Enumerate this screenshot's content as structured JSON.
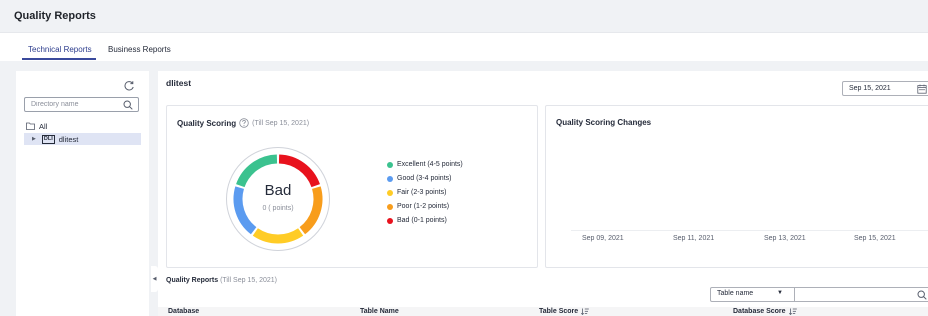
{
  "header": {
    "title": "Quality Reports"
  },
  "tabs": [
    {
      "label": "Technical Reports",
      "active": true
    },
    {
      "label": "Business Reports",
      "active": false
    }
  ],
  "sidebar": {
    "search_placeholder": "Directory name",
    "tree": {
      "root_label": "All",
      "badge": "DLI",
      "db_label": "dlitest"
    }
  },
  "main": {
    "database_title": "dlitest",
    "date_value": "Sep 15, 2021"
  },
  "scoring": {
    "title": "Quality Scoring",
    "subtitle": "(Till Sep 15, 2021)",
    "grade": "Bad",
    "points": "0 ( points)",
    "legend": [
      {
        "label": "Excellent (4-5 points)",
        "color": "#3bc28f"
      },
      {
        "label": "Good (3-4 points)",
        "color": "#5b9bf0"
      },
      {
        "label": "Fair (2-3 points)",
        "color": "#ffcc26"
      },
      {
        "label": "Poor (1-2 points)",
        "color": "#f89d1c"
      },
      {
        "label": "Bad (0-1 points)",
        "color": "#e8121d"
      }
    ]
  },
  "changes": {
    "title": "Quality Scoring Changes",
    "x_labels": [
      "Sep 09, 2021",
      "Sep 11, 2021",
      "Sep 13, 2021",
      "Sep 15, 2021"
    ]
  },
  "reports": {
    "title": "Quality Reports",
    "subtitle": "(Till Sep 15, 2021)",
    "filter_select": "Table name",
    "columns": [
      "Database",
      "Table Name",
      "Table Score",
      "Database Score"
    ]
  },
  "colors": {
    "accent": "#3a4a9c",
    "selected_row": "#dfe4f4",
    "page_bg": "#f0f2f5"
  }
}
